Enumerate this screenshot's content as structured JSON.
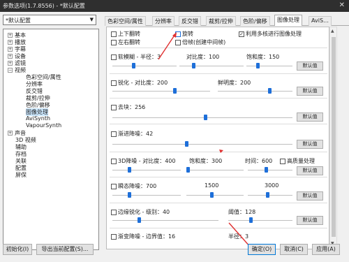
{
  "window": {
    "title": "参数选项(1.7.8556) - *默认配置",
    "close": "✕"
  },
  "preset": {
    "value": "*默认配置"
  },
  "tree": [
    {
      "label": "基本",
      "expander": "+"
    },
    {
      "label": "播放",
      "expander": "+"
    },
    {
      "label": "字幕",
      "expander": "+"
    },
    {
      "label": "设备",
      "expander": "+"
    },
    {
      "label": "滤镜",
      "expander": "+"
    },
    {
      "label": "视频",
      "expander": "−"
    },
    {
      "label": "色彩空间/属性"
    },
    {
      "label": "分辨率"
    },
    {
      "label": "反交错"
    },
    {
      "label": "裁剪/拉伸"
    },
    {
      "label": "色阶/偏移"
    },
    {
      "label": "图像处理"
    },
    {
      "label": "AviSynth"
    },
    {
      "label": "VapourSynth"
    },
    {
      "label": "声音",
      "expander": "+"
    },
    {
      "label": "3D 视频"
    },
    {
      "label": "辅助"
    },
    {
      "label": "存档"
    },
    {
      "label": "关联"
    },
    {
      "label": "配置"
    },
    {
      "label": "屏保"
    }
  ],
  "tabs": [
    "色彩空间/属性",
    "分辨率",
    "反交错",
    "裁剪/拉伸",
    "色阶/偏移",
    "图像处理",
    "AviS…"
  ],
  "active_tab": "图像处理",
  "options": {
    "flip_v": "上下翻转",
    "flip_h": "左右翻转",
    "rotate": "旋转",
    "double_frame": "倍帧(创建中间帧)",
    "multicore": "利用多核进行图像处理"
  },
  "sections": {
    "soften": {
      "label": "软模糊 - 半径：3",
      "contrast": "对比度：100",
      "saturation": "饱和度：150"
    },
    "sharpen": {
      "label": "锐化 - 对比度：200",
      "brightness": "鲜明度：200"
    },
    "deblock": {
      "label": "去块：256"
    },
    "denoise": {
      "label": "渐进降噪：42"
    },
    "denoise3d": {
      "label": "3D降噪 - 对比度：400",
      "saturation": "饱和度：300",
      "time": "时间：600",
      "hq": "高质量处理"
    },
    "tdenoise": {
      "label": "瞬态降噪：700",
      "v2": "1500",
      "v3": "3000"
    },
    "edge": {
      "label": "边缘锐化 - 级别：40",
      "threshold": "阈值：128"
    },
    "last": {
      "label": "渐变降噪 - 边界值：16",
      "v2": "半径：3"
    }
  },
  "default_label": "默认值",
  "buttons": {
    "init": "初始化(I)",
    "export": "导出当前配置(S)...",
    "ok": "确定(O)",
    "cancel": "取消(C)",
    "apply": "应用(A)"
  },
  "accent": "#1e6fd9",
  "annotation_color": "#e03030"
}
